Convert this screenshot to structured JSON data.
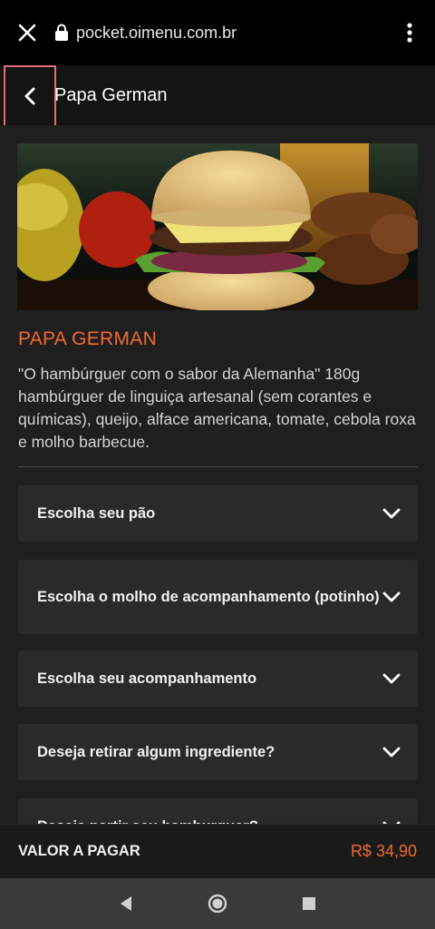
{
  "browser": {
    "url": "pocket.oimenu.com.br"
  },
  "header": {
    "title": "Papa German"
  },
  "product": {
    "name": "PAPA GERMAN",
    "description": "\"O hambúrguer com o sabor da Alemanha\" 180g hambúrguer de linguiça artesanal (sem corantes e químicas), queijo, alface americana, tomate, cebola roxa e molho barbecue."
  },
  "options": [
    {
      "label": "Escolha seu pão"
    },
    {
      "label": "Escolha o molho de acompanhamento (potinho)"
    },
    {
      "label": "Escolha seu acompanhamento"
    },
    {
      "label": "Deseja retirar algum ingrediente?"
    },
    {
      "label": "Deseja partir seu hamburguer?"
    }
  ],
  "footer": {
    "label": "VALOR A PAGAR",
    "price": "R$ 34,90"
  },
  "colors": {
    "accent": "#f26a2e",
    "background": "#1f1f1f",
    "card": "#2a2a2a",
    "highlight": "#e06b7a"
  }
}
